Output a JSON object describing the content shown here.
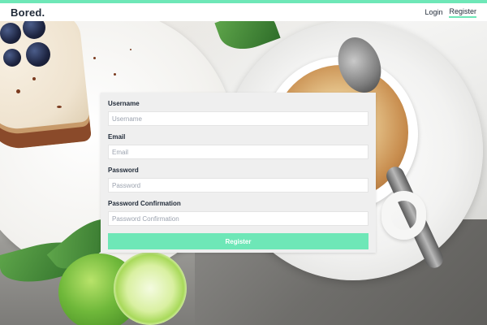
{
  "app": {
    "brand": "Bored.",
    "accent_color": "#6ee7b7"
  },
  "nav": {
    "items": [
      {
        "label": "Login",
        "active": false
      },
      {
        "label": "Register",
        "active": true
      }
    ]
  },
  "form": {
    "fields": [
      {
        "label": "Username",
        "placeholder": "Username",
        "value": ""
      },
      {
        "label": "Email",
        "placeholder": "Email",
        "value": ""
      },
      {
        "label": "Password",
        "placeholder": "Password",
        "value": ""
      },
      {
        "label": "Password Confirmation",
        "placeholder": "Password Confirmation",
        "value": ""
      }
    ],
    "submit_label": "Register"
  },
  "background": {
    "image": "coffee-cake-lime-photo"
  }
}
